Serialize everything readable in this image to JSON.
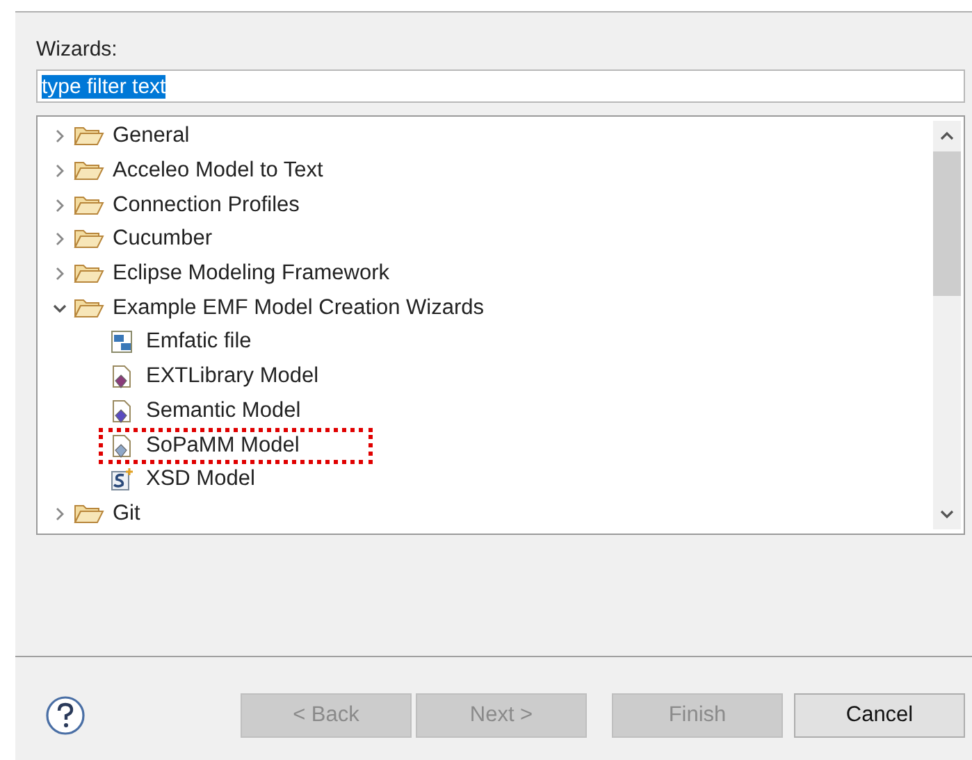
{
  "wizards_label": "Wizards:",
  "filter": {
    "value": "type filter text",
    "highlighted": true
  },
  "tree": [
    {
      "label": "General",
      "kind": "folder",
      "expanded": false,
      "annotated": false
    },
    {
      "label": "Acceleo Model to Text",
      "kind": "folder",
      "expanded": false,
      "annotated": false
    },
    {
      "label": "Connection Profiles",
      "kind": "folder",
      "expanded": false,
      "annotated": false
    },
    {
      "label": "Cucumber",
      "kind": "folder",
      "expanded": false,
      "annotated": false
    },
    {
      "label": "Eclipse Modeling Framework",
      "kind": "folder",
      "expanded": false,
      "annotated": false
    },
    {
      "label": "Example EMF Model Creation Wizards",
      "kind": "folder",
      "expanded": true,
      "annotated": false,
      "children": [
        {
          "label": "Emfatic file",
          "kind": "emfatic",
          "annotated": false
        },
        {
          "label": "EXTLibrary Model",
          "kind": "library",
          "annotated": false
        },
        {
          "label": "Semantic Model",
          "kind": "semantic",
          "annotated": false
        },
        {
          "label": "SoPaMM Model",
          "kind": "sopamm",
          "annotated": true
        },
        {
          "label": "XSD Model",
          "kind": "xsd",
          "annotated": false
        }
      ]
    },
    {
      "label": "Git",
      "kind": "folder",
      "expanded": false,
      "annotated": false
    }
  ],
  "buttons": [
    {
      "label": "< Back",
      "disabled": true
    },
    {
      "label": "Next >",
      "disabled": true
    },
    {
      "label": "Finish",
      "disabled": true
    },
    {
      "label": "Cancel",
      "disabled": false
    }
  ]
}
